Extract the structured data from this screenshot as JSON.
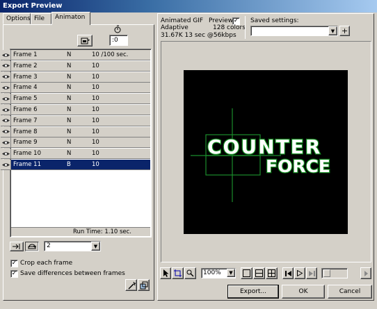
{
  "window": {
    "title": "Export Preview"
  },
  "tabs": [
    {
      "label": "Options"
    },
    {
      "label": "File"
    },
    {
      "label": "Animaton"
    }
  ],
  "frame_delay": {
    "value": ":0"
  },
  "frames": [
    {
      "name": "Frame 1",
      "disposal": "N",
      "delay": "10 /100 sec."
    },
    {
      "name": "Frame 2",
      "disposal": "N",
      "delay": "10"
    },
    {
      "name": "Frame 3",
      "disposal": "N",
      "delay": "10"
    },
    {
      "name": "Frame 4",
      "disposal": "N",
      "delay": "10"
    },
    {
      "name": "Frame 5",
      "disposal": "N",
      "delay": "10"
    },
    {
      "name": "Frame 6",
      "disposal": "N",
      "delay": "10"
    },
    {
      "name": "Frame 7",
      "disposal": "N",
      "delay": "10"
    },
    {
      "name": "Frame 8",
      "disposal": "N",
      "delay": "10"
    },
    {
      "name": "Frame 9",
      "disposal": "N",
      "delay": "10"
    },
    {
      "name": "Frame 10",
      "disposal": "N",
      "delay": "10"
    },
    {
      "name": "Frame 11",
      "disposal": "B",
      "delay": "10"
    }
  ],
  "run_time": "Run Time: 1.10 sec.",
  "loop_count": "2",
  "crop_each_frame": {
    "label": "Crop each frame",
    "checked": true
  },
  "save_differences": {
    "label": "Save differences between frames",
    "checked": true
  },
  "preview_info": {
    "format": "Animated GIF",
    "palette": "Adaptive",
    "size": "31.67K  13 sec @56kbps",
    "preview_label": "Preview",
    "colors": "128 colors",
    "saved_settings_label": "Saved settings:"
  },
  "artwork": {
    "line1": "COUNTER",
    "line2": "FORCE"
  },
  "zoom": "100%",
  "buttons": {
    "export": "Export...",
    "ok": "OK",
    "cancel": "Cancel"
  },
  "colors": {
    "selection": "#0a246a",
    "canvas": "#000000",
    "guide": "#1a8c2c",
    "text_fill": "#ffffff",
    "text_outline": "#118a1f"
  }
}
